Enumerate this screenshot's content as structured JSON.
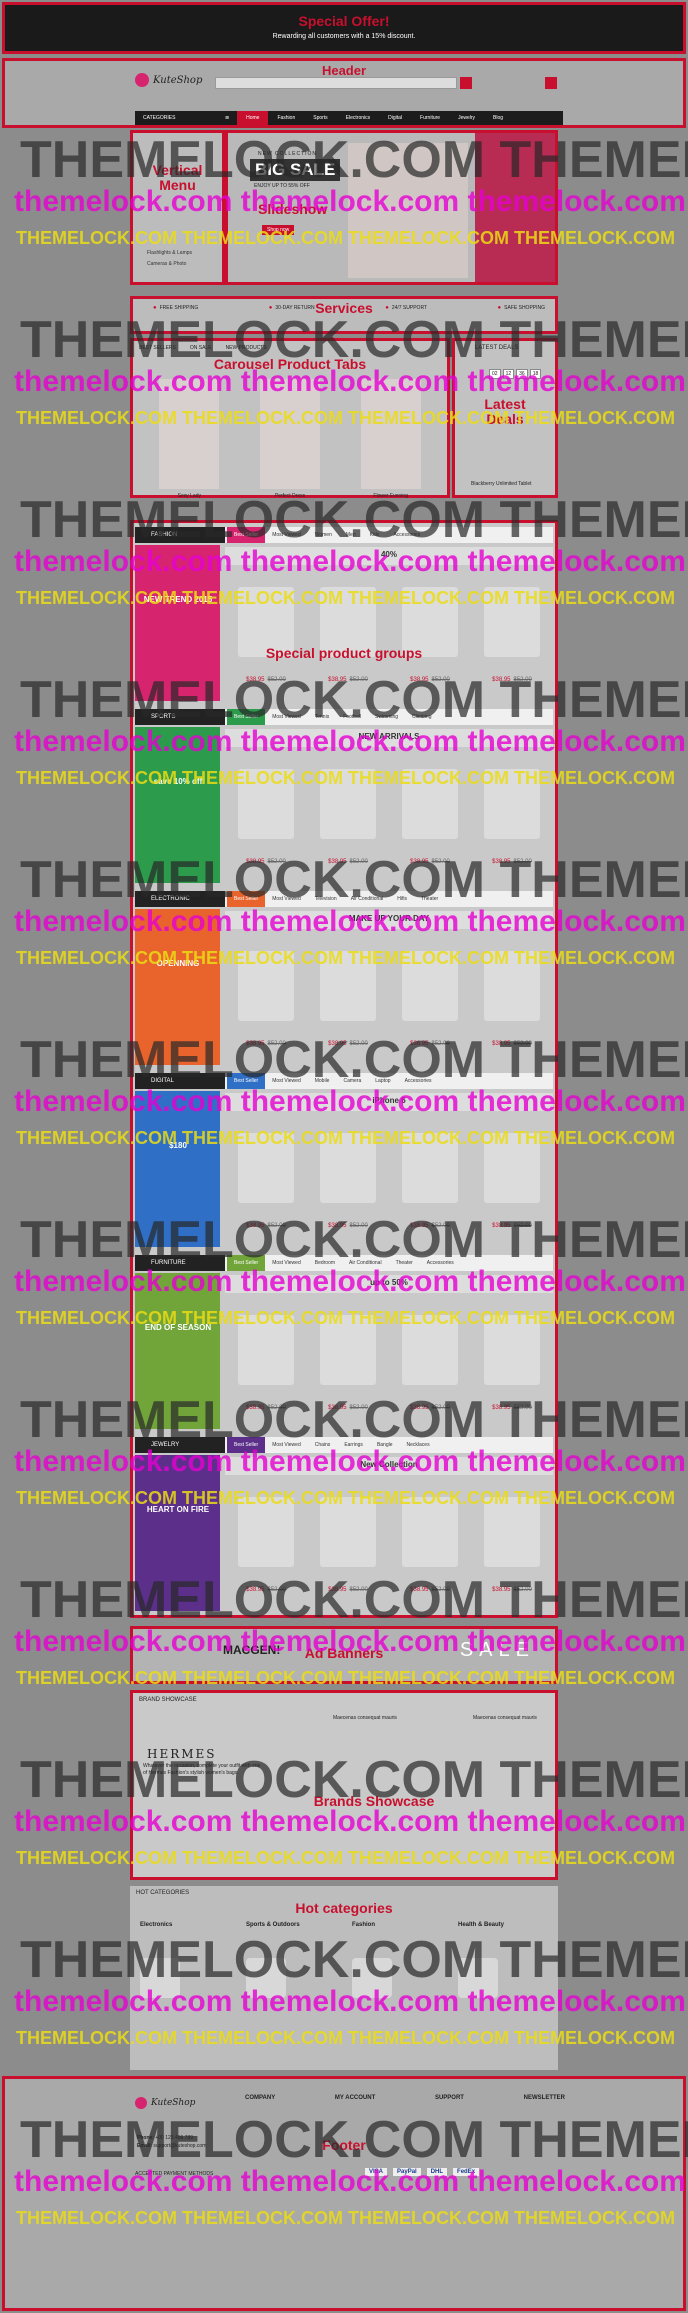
{
  "special_offer": {
    "title": "Special Offer!",
    "subtitle": "Rewarding all customers with a 15% discount."
  },
  "header": {
    "label": "Header",
    "logo_text": "KuteShop",
    "categories_label": "CATEGORIES",
    "nav": [
      "Home",
      "Fashion",
      "Sports",
      "Electronics",
      "Digital",
      "Furniture",
      "Jewelry",
      "Blog"
    ]
  },
  "vertical_menu": {
    "label": "Vertical Menu",
    "items": [
      "Flashlights & Lamps",
      "Cameras & Photo"
    ]
  },
  "slideshow": {
    "label": "Slideshow",
    "tag": "NEW COLLECTION",
    "title": "BIG SALE",
    "subtitle": "ENJOY UP TO 55% OFF",
    "button": "Shop now"
  },
  "services": {
    "label": "Services",
    "items": [
      "FREE SHIPPING",
      "30-DAY RETURN",
      "24/7 SUPPORT",
      "SAFE SHOPPING"
    ]
  },
  "carousel": {
    "label": "Carousel Product Tabs",
    "tabs": [
      "BEST SELLERS",
      "ON SALE",
      "NEW PRODUCTS"
    ],
    "products": [
      "Sexy Lady",
      "Perfect Dress",
      "Flower Evening"
    ]
  },
  "latest_deals": {
    "label": "Latest Deals",
    "title": "LATEST DEALS",
    "countdown": [
      "02",
      "12",
      "36",
      "18"
    ],
    "product": "Blackberry Unlimited Tablet"
  },
  "special_groups": {
    "label": "Special product groups",
    "sections": [
      {
        "name": "FASHION",
        "color": "#d6246e",
        "tabs": [
          "Best Seller",
          "Most Viewed",
          "Women",
          "Men",
          "Kids",
          "Accessories"
        ],
        "banner": "NEW TREND 2015",
        "promo": "40%"
      },
      {
        "name": "SPORTS",
        "color": "#2c9b4c",
        "tabs": [
          "Best Seller",
          "Most Viewed",
          "Tennis",
          "Football",
          "Swimming",
          "Climbing"
        ],
        "banner": "save 10% off",
        "promo": "NEW ARRIVALS"
      },
      {
        "name": "ELECTRONIC",
        "color": "#e8642c",
        "tabs": [
          "Best Seller",
          "Most Viewed",
          "Television",
          "Air Conditional",
          "Hifis",
          "Theater"
        ],
        "banner": "OPENNING",
        "promo": "MAKE UP YOUR DAY"
      },
      {
        "name": "DIGITAL",
        "color": "#2f6fc6",
        "tabs": [
          "Best Seller",
          "Most Viewed",
          "Mobile",
          "Camera",
          "Laptop",
          "Accessories"
        ],
        "banner": "$180",
        "promo": "iPhone 6"
      },
      {
        "name": "FURNITURE",
        "color": "#71a53a",
        "tabs": [
          "Best Seller",
          "Most Viewed",
          "Bedroom",
          "Air Conditional",
          "Theater",
          "Accessories"
        ],
        "banner": "END OF SEASON",
        "promo": "up to 50%"
      },
      {
        "name": "JEWELRY",
        "color": "#5c2f8a",
        "tabs": [
          "Best Seller",
          "Most Viewed",
          "Chains",
          "Earrings",
          "Bangle",
          "Necklaces"
        ],
        "banner": "HEART ON FIRE",
        "promo": "New Collection"
      }
    ],
    "price": "$38.95",
    "old_price": "$52.00"
  },
  "adbanners": {
    "label": "Ad Banners",
    "left": "MACGEN!",
    "right": "SALE"
  },
  "brands": {
    "label": "Brands Showcase",
    "title": "BRAND SHOWCASE",
    "brand": "HERMES",
    "brand_text": "Whatever the occasion, complete your outfit with one of Hermes Fashion's stylish women's bags.",
    "products": [
      "Maecenas consequat mauris",
      "Maecenas consequat mauris"
    ]
  },
  "hot_categories": {
    "label": "Hot categories",
    "title": "HOT CATEGORIES",
    "cats": [
      "Electronics",
      "Sports & Outdoors",
      "Fashion",
      "Health & Beauty"
    ]
  },
  "footer": {
    "label": "Footer",
    "logo_text": "KuteShop",
    "columns": [
      "COMPANY",
      "MY ACCOUNT",
      "SUPPORT",
      "NEWSLETTER"
    ],
    "phone_label": "Phone:",
    "phone": "+00 123 456 789",
    "email_label": "Email:",
    "email": "support@kuteshop.com",
    "payment_title": "ACCEPTED PAYMENT METHODS",
    "payments": [
      "VISA",
      "PayPal",
      "DHL",
      "FedEx"
    ]
  },
  "watermark": {
    "dark": "THEMELOCK.COM",
    "light": "themelock.com"
  }
}
